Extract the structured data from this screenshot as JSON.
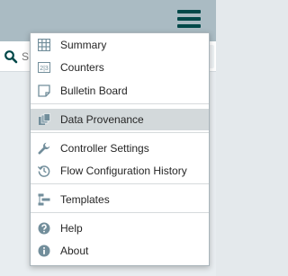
{
  "search": {
    "placeholder": "S"
  },
  "icon_color": "#728e9b",
  "menu": {
    "summary_label": "Summary",
    "counters_label": "Counters",
    "counters_icon_text": "2|3",
    "bulletin_board_label": "Bulletin Board",
    "data_provenance_label": "Data Provenance",
    "controller_settings_label": "Controller Settings",
    "flow_configuration_history_label": "Flow Configuration History",
    "templates_label": "Templates",
    "help_label": "Help",
    "about_label": "About",
    "active_item": "Data Provenance"
  },
  "icons": {
    "hamburger": "menu-icon",
    "search": "search-icon",
    "summary": "table-icon",
    "counters": "counter-icon",
    "bulletin_board": "sticky-note-icon",
    "data_provenance": "provenance-icon",
    "controller_settings": "wrench-icon",
    "flow_configuration_history": "history-icon",
    "templates": "templates-icon",
    "help": "question-circle-icon",
    "about": "info-circle-icon"
  }
}
